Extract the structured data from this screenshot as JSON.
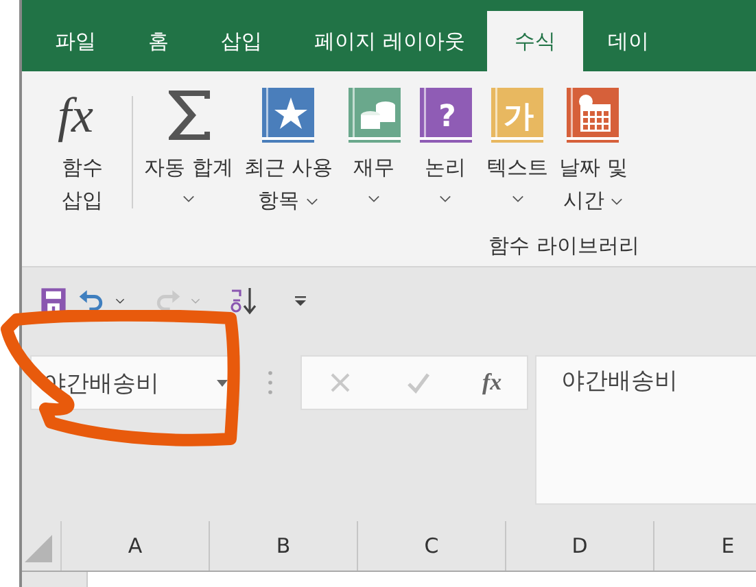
{
  "tabs": [
    {
      "label": "파일",
      "selected": false
    },
    {
      "label": "홈",
      "selected": false
    },
    {
      "label": "삽입",
      "selected": false
    },
    {
      "label": "페이지 레이아웃",
      "selected": false
    },
    {
      "label": "수식",
      "selected": true
    },
    {
      "label": "데이",
      "selected": false
    }
  ],
  "ribbon": {
    "buttons": [
      {
        "kind": "fx",
        "glyph": "fx",
        "label": "함수\n삽입",
        "dropdown": false
      },
      {
        "kind": "sum",
        "label": "자동 합계",
        "dropdown": true
      },
      {
        "kind": "star",
        "color": "#4a7ebb",
        "label": "최근 사용\n항목",
        "dropdown": true
      },
      {
        "kind": "coins",
        "color": "#6aa88c",
        "label": "재무",
        "dropdown": true
      },
      {
        "kind": "glyph",
        "color": "#8f5cb5",
        "glyph": "?",
        "label": "논리",
        "dropdown": true
      },
      {
        "kind": "glyph",
        "color": "#e8b860",
        "glyph": "가",
        "label": "텍스트",
        "dropdown": true
      },
      {
        "kind": "calendar",
        "color": "#d6603a",
        "label": "날짜 및\n시간",
        "dropdown": true
      }
    ],
    "group_label": "함수 라이브러리"
  },
  "quick_access": [
    {
      "kind": "save",
      "dropdown": false,
      "disabled": false
    },
    {
      "kind": "undo",
      "dropdown": true,
      "disabled": false
    },
    {
      "kind": "redo",
      "dropdown": true,
      "disabled": true
    },
    {
      "kind": "sort",
      "dropdown": false,
      "disabled": false
    },
    {
      "kind": "customize",
      "dropdown": false,
      "disabled": false
    }
  ],
  "name_box": {
    "value": "야간배송비"
  },
  "formula_bar": {
    "cancel_disabled": true,
    "enter_disabled": true,
    "function_glyph": "fx",
    "value": "야간배송비"
  },
  "columns": [
    "A",
    "B",
    "C",
    "D",
    "E"
  ],
  "annotation": {
    "kind": "loop"
  }
}
